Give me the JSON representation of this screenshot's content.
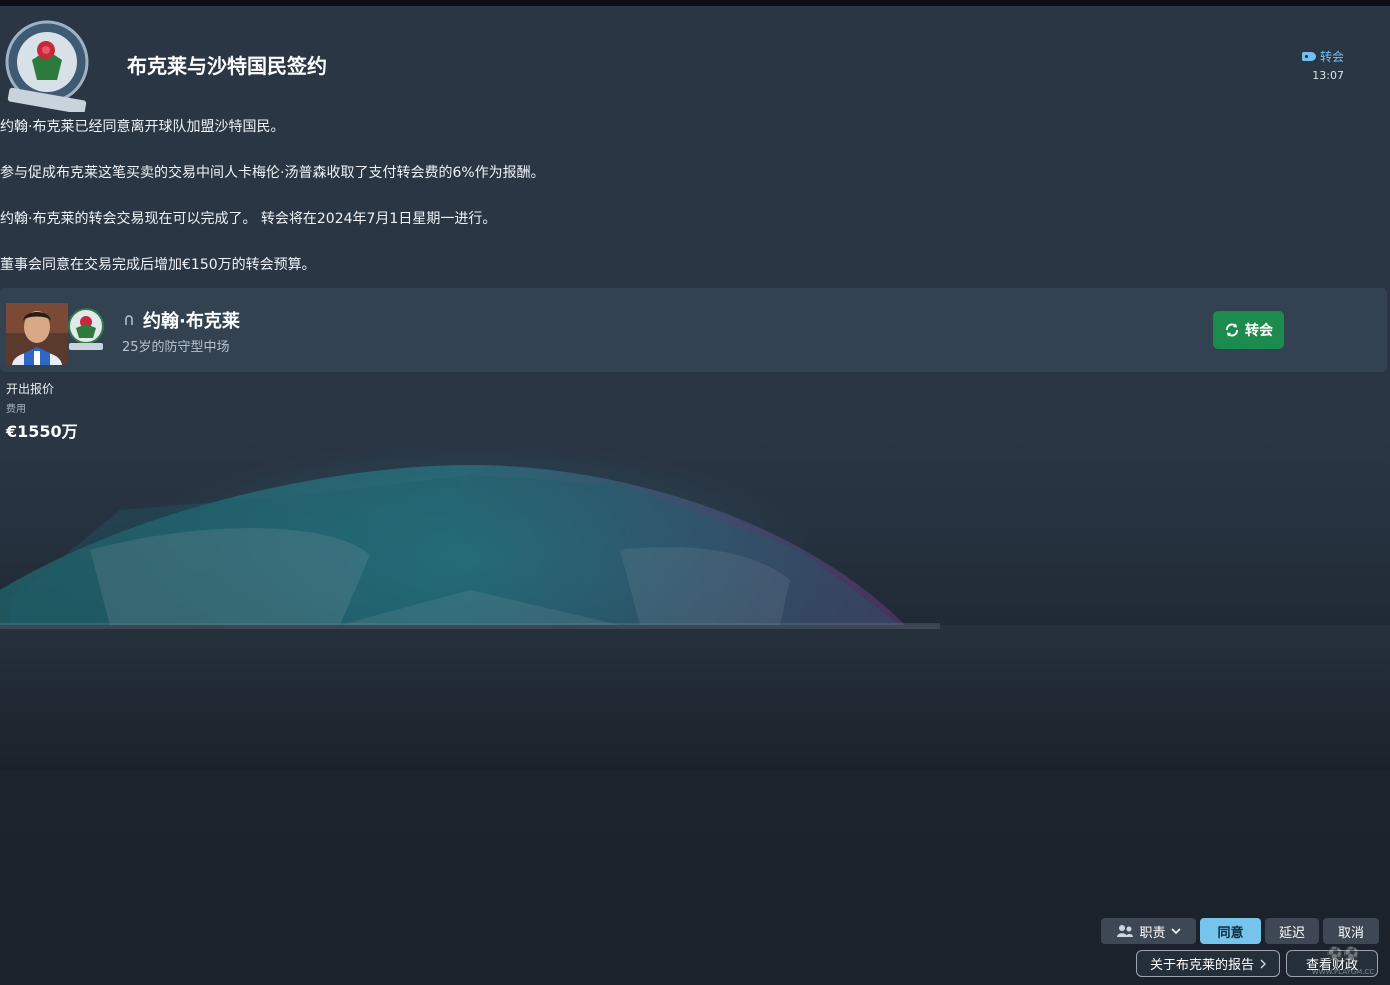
{
  "header": {
    "title": "布克莱与沙特国民签约",
    "tag_label": "转会",
    "time": "13:07"
  },
  "body": {
    "paragraphs": [
      "约翰·布克莱已经同意离开球队加盟沙特国民。",
      "参与促成布克莱这笔买卖的交易中间人卡梅伦·汤普森收取了支付转会费的6%作为报酬。",
      "约翰·布克莱的转会交易现在可以完成了。 转会将在2024年7月1日星期一进行。",
      "董事会同意在交易完成后增加€150万的转会预算。"
    ]
  },
  "player": {
    "name": "约翰·布克莱",
    "description": "25岁的防守型中场",
    "transfer_button": "转会"
  },
  "offer": {
    "label": "开出报价",
    "fee_label": "费用",
    "fee_value": "€1550万"
  },
  "actions": {
    "duty": "职责",
    "agree": "同意",
    "delay": "延迟",
    "cancel": "取消",
    "report": "关于布克莱的报告",
    "finance": "查看财政"
  },
  "watermark": {
    "text": "WWW.PLAYGM.CC"
  },
  "colors": {
    "accent_blue": "#76c4ec",
    "transfer_green": "#1b8c4e",
    "background": "#1f2a35"
  }
}
